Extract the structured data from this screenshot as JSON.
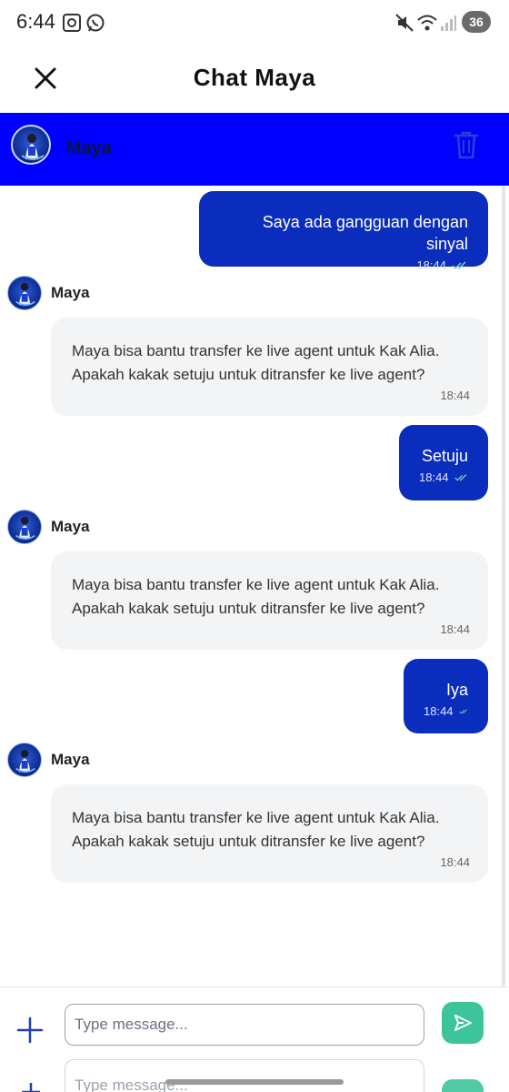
{
  "status_bar": {
    "time": "6:44",
    "battery": "36",
    "icons": [
      "screenshot-icon",
      "whatsapp-icon",
      "mute-icon",
      "wifi-icon",
      "signal-icon"
    ]
  },
  "title_bar": {
    "title": "Chat Maya",
    "close_icon": "close-icon"
  },
  "chat_header": {
    "name": "Maya",
    "color": "#0000ff",
    "delete_icon": "trash-icon"
  },
  "messages": [
    {
      "type": "out",
      "text": "Saya ada gangguan dengan sinyal",
      "time": "18:44"
    },
    {
      "type": "in",
      "sender": "Maya",
      "text": "Maya bisa bantu transfer ke live agent untuk Kak Alia. Apakah kakak setuju untuk ditransfer ke live agent?",
      "time": "18:44"
    },
    {
      "type": "out",
      "text": "Setuju",
      "time": "18:44"
    },
    {
      "type": "in",
      "sender": "Maya",
      "text": "Maya bisa bantu transfer ke live agent untuk Kak Alia. Apakah kakak setuju untuk ditransfer ke live agent?",
      "time": "18:44"
    },
    {
      "type": "out",
      "text": "Iya",
      "time": "18:44"
    },
    {
      "type": "in",
      "sender": "Maya",
      "text": "Maya bisa bantu transfer ke live agent untuk Kak Alia. Apakah kakak setuju untuk ditransfer ke live agent?",
      "time": "18:44"
    }
  ],
  "composer": {
    "placeholder": "Type message...",
    "value": "",
    "send_color": "#3cc49a"
  },
  "colors": {
    "outgoing_bubble": "#0a2dbd",
    "incoming_bubble": "#f3f4f6",
    "accent": "#0000ff"
  }
}
